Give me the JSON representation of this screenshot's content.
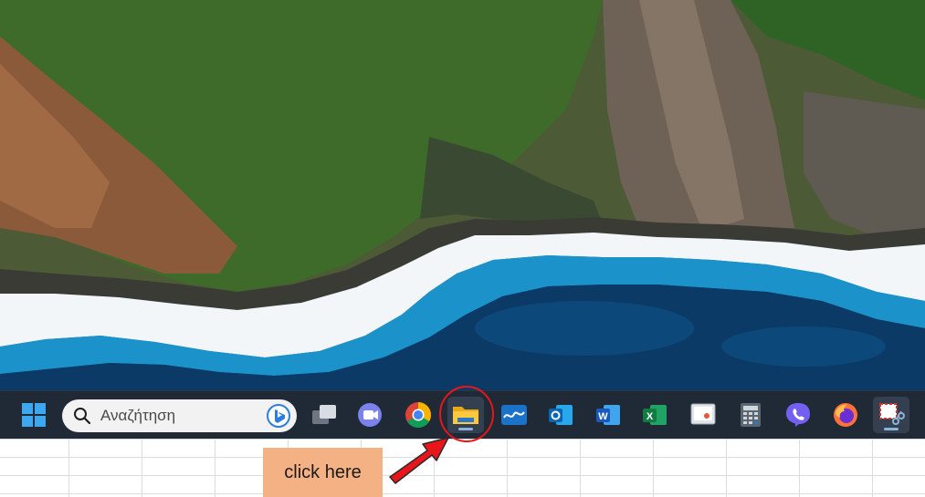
{
  "search": {
    "placeholder": "Αναζήτηση"
  },
  "annotation": {
    "label": "click here"
  },
  "taskbar": {
    "icons": [
      "start-icon",
      "task-view-icon",
      "teams-chat-icon",
      "chrome-icon",
      "file-explorer-icon",
      "whiteboard-icon",
      "outlook-icon",
      "word-icon",
      "excel-icon",
      "remote-desktop-icon",
      "calculator-icon",
      "viber-icon",
      "firefox-icon",
      "snipping-tool-icon"
    ]
  },
  "colors": {
    "taskbar_bg": "#202a36",
    "callout_bg": "#f4b183",
    "arrow_red": "#e8151b"
  }
}
